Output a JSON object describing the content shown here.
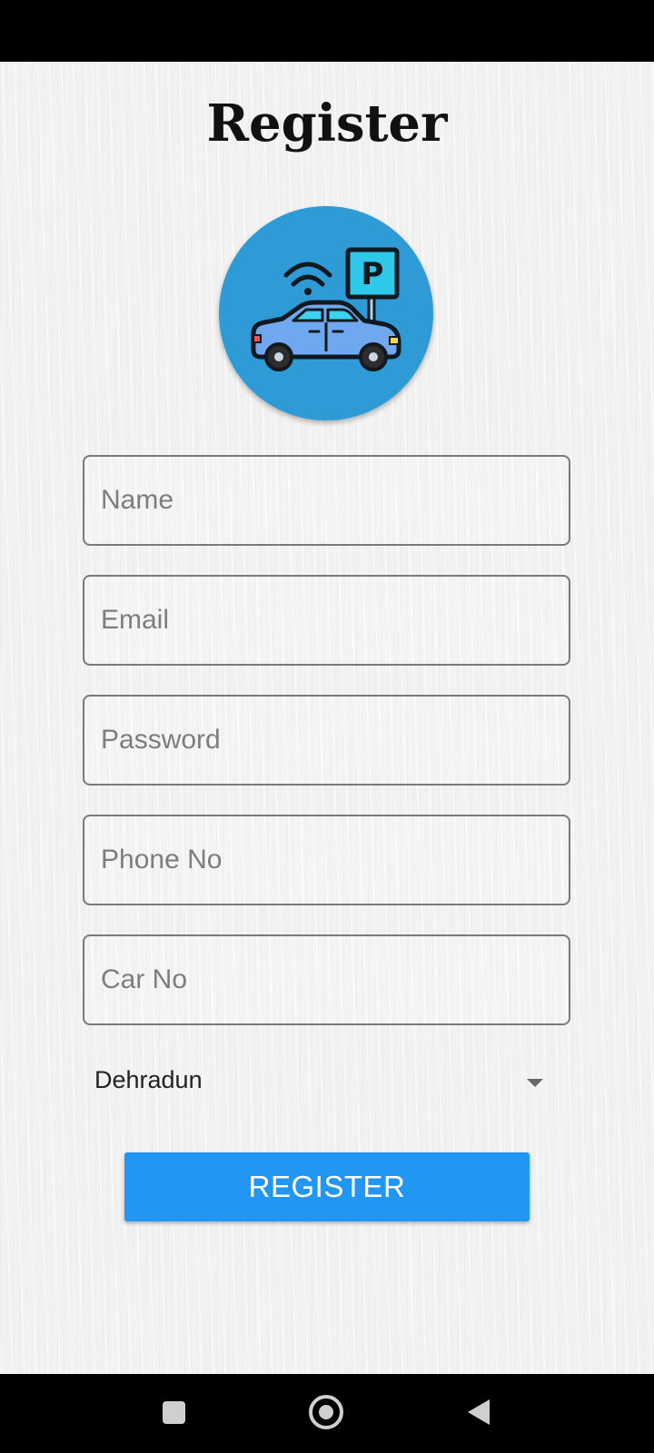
{
  "screen": {
    "title": "Register"
  },
  "logo": {
    "icon": "smart-parking-car-icon",
    "sign_letter": "P"
  },
  "form": {
    "name_placeholder": "Name",
    "email_placeholder": "Email",
    "password_placeholder": "Password",
    "phone_placeholder": "Phone No",
    "car_placeholder": "Car No",
    "city_selected": "Dehradun",
    "register_label": "REGISTER"
  },
  "colors": {
    "primary_button": "#2196f3",
    "logo_background": "#2f9bd6"
  },
  "navigation": {
    "recents_icon": "square-icon",
    "home_icon": "circle-icon",
    "back_icon": "triangle-back-icon"
  }
}
